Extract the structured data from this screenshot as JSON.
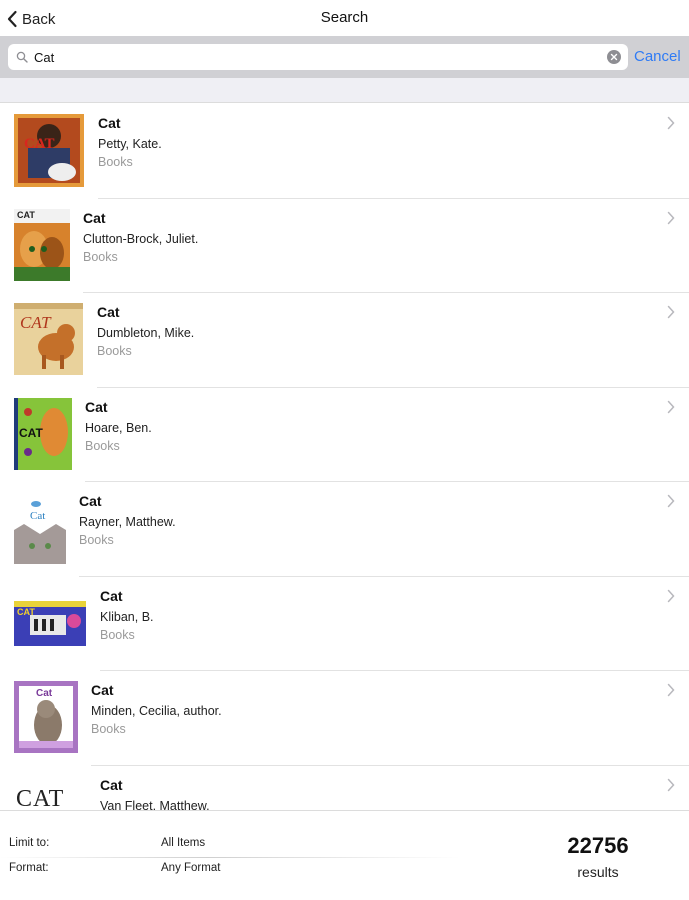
{
  "navbar": {
    "back_label": "Back",
    "title": "Search"
  },
  "search": {
    "value": "Cat",
    "cancel_label": "Cancel"
  },
  "results": [
    {
      "title": "Cat",
      "author": "Petty, Kate.",
      "format": "Books"
    },
    {
      "title": "Cat",
      "author": "Clutton-Brock, Juliet.",
      "format": "Books"
    },
    {
      "title": "Cat",
      "author": "Dumbleton, Mike.",
      "format": "Books"
    },
    {
      "title": "Cat",
      "author": "Hoare, Ben.",
      "format": "Books"
    },
    {
      "title": "Cat",
      "author": "Rayner, Matthew.",
      "format": "Books"
    },
    {
      "title": "Cat",
      "author": "Kliban, B.",
      "format": "Books"
    },
    {
      "title": "Cat",
      "author": "Minden, Cecilia, author.",
      "format": "Books"
    },
    {
      "title": "Cat",
      "author": "Van Fleet, Matthew.",
      "format": ""
    }
  ],
  "covers": {
    "c1_text": "CAT",
    "c2_text": "CAT",
    "c3_text": "CAT",
    "c4_text": "CAT",
    "c5_text": "Cat",
    "c6_text": "CAT",
    "c7_text": "Cat",
    "c8_text": "CAT"
  },
  "footer": {
    "limit_label": "Limit to:",
    "limit_value": "All Items",
    "format_label": "Format:",
    "format_value": "Any Format",
    "count": "22756",
    "count_label": "results"
  },
  "colors": {
    "accent": "#2f7bf5",
    "search_bar_bg": "#d0d0d4",
    "secondary_text": "#9a9a9a"
  },
  "icons": {
    "back": "chevron-left-icon",
    "search": "magnifier-icon",
    "clear": "clear-x-icon",
    "disclosure": "chevron-right-icon"
  }
}
